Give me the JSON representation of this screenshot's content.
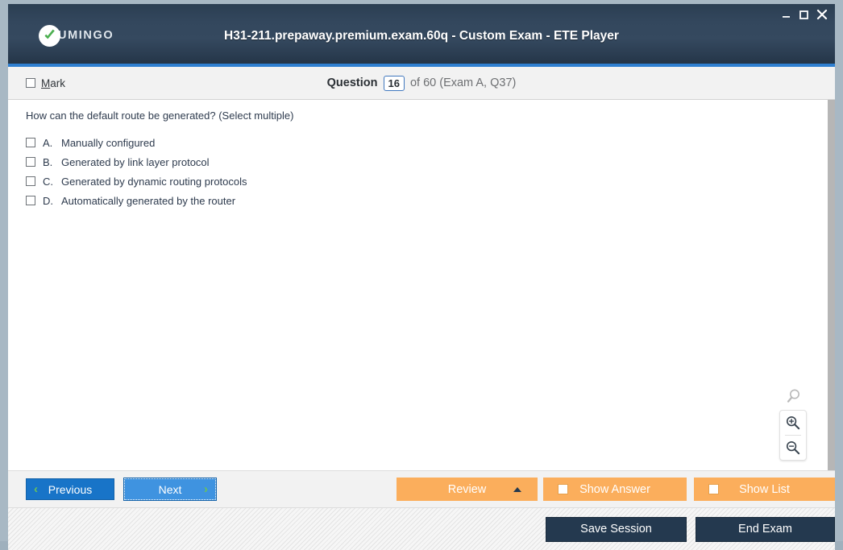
{
  "window": {
    "title": "H31-211.prepaway.premium.exam.60q - Custom Exam - ETE Player",
    "logo_text": "UMINGO",
    "controls": {
      "minimize": "—",
      "maximize": "□",
      "close": "✕"
    },
    "accent_color": "#2f7fd0",
    "titlebar_color": "#35495f"
  },
  "question_bar": {
    "mark_label_prefix": "M",
    "mark_label_rest": "ark",
    "question_label": "Question",
    "question_number": "16",
    "of_text": "of 60 (Exam A, Q37)"
  },
  "question": {
    "text": "How can the default route be generated? (Select multiple)",
    "options": [
      {
        "letter": "A.",
        "text": "Manually configured",
        "checked": false
      },
      {
        "letter": "B.",
        "text": "Generated by link layer protocol",
        "checked": false
      },
      {
        "letter": "C.",
        "text": "Generated by dynamic routing protocols",
        "checked": false
      },
      {
        "letter": "D.",
        "text": "Automatically generated by the router",
        "checked": false
      }
    ]
  },
  "zoom_tools": {
    "reset": "search-icon",
    "zoom_in": "zoom-in-icon",
    "zoom_out": "zoom-out-icon"
  },
  "toolbar": {
    "previous": "Previous",
    "next": "Next",
    "review": "Review",
    "show_answer": "Show Answer",
    "show_list": "Show List",
    "orange_color": "#fbae5c",
    "prev_color": "#1874c8",
    "next_color": "#3f93e0",
    "chevron_color": "#6ac259"
  },
  "footer": {
    "save_session": "Save Session",
    "end_exam": "End Exam",
    "button_color": "#24394f"
  }
}
